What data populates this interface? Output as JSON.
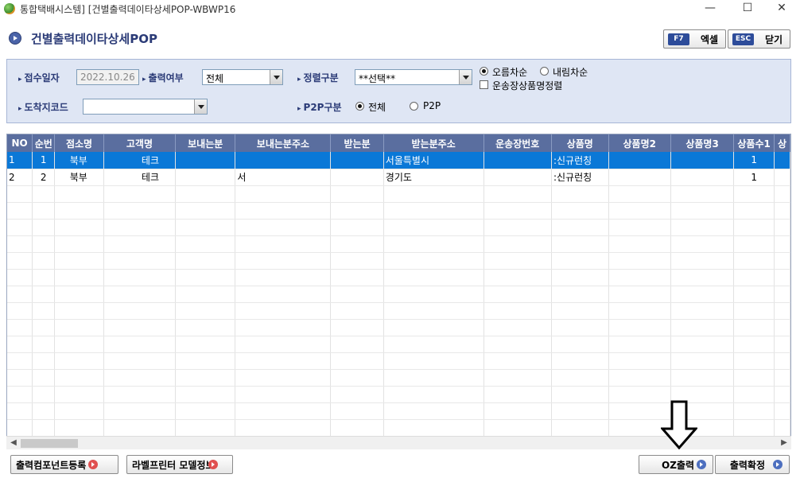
{
  "window": {
    "title": "통합택배시스템] [건별출력데이타상세POP-WBWP16",
    "minimize": "—",
    "maximize": "☐",
    "close": "✕"
  },
  "header": {
    "title": "건별출력데이타상세POP",
    "excel_key": "F7",
    "excel_label": "엑셀",
    "close_key": "ESC",
    "close_label": "닫기"
  },
  "filter": {
    "receipt_date_label": "접수일자",
    "receipt_date_value": "2022.10.26",
    "print_status_label": "출력여부",
    "print_status_value": "전체",
    "sort_type_label": "정렬구분",
    "sort_type_value": "**선택**",
    "asc_label": "오름차순",
    "desc_label": "내림차순",
    "waybill_sort_label": "운송장상품명정렬",
    "dest_code_label": "도착지코드",
    "dest_code_value": "",
    "p2p_label": "P2P구분",
    "p2p_all_label": "전체",
    "p2p_p2p_label": "P2P"
  },
  "grid": {
    "columns": [
      "NO",
      "순번",
      "점소명",
      "고객명",
      "보내는분",
      "보내는분주소",
      "받는분",
      "받는분주소",
      "운송장번호",
      "상품명",
      "상품명2",
      "상품명3",
      "상품수1",
      "상"
    ],
    "rows": [
      {
        "no": "1",
        "seq": "1",
        "branch": "북부",
        "customer": "테크",
        "sender": "",
        "sender_addr": "",
        "receiver": "",
        "receiver_addr": "서울특별시",
        "waybill": "",
        "product": ":신규런칭",
        "product2": "",
        "product3": "",
        "qty1": "1"
      },
      {
        "no": "2",
        "seq": "2",
        "branch": "북부",
        "customer": "테크",
        "sender": "",
        "sender_addr": "서",
        "receiver": "",
        "receiver_addr": "경기도",
        "waybill": "",
        "product": ":신규런칭",
        "product2": "",
        "product3": "",
        "qty1": "1"
      }
    ]
  },
  "scroll": {
    "left": "◀",
    "right": "▶"
  },
  "footer": {
    "register_component": "출력컴포넌트등록",
    "label_printer_model": "라벨프린터 모델정보",
    "oz_print": "OZ출력",
    "print_confirm": "출력확정"
  }
}
